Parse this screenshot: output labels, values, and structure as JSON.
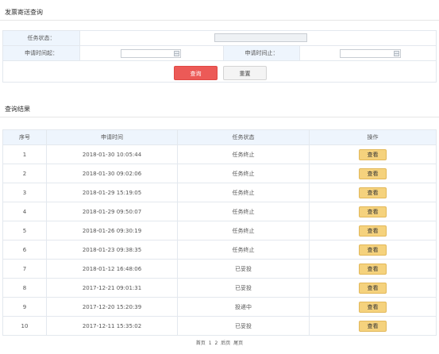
{
  "search_panel": {
    "title": "发票寄送查询"
  },
  "form": {
    "status_label": "任务状态：",
    "start_label": "申请时间起：",
    "end_label": "申请时间止：",
    "query_button": "查询",
    "reset_button": "重置"
  },
  "results_panel": {
    "title": "查询结果"
  },
  "table": {
    "headers": [
      "序号",
      "申请时间",
      "任务状态",
      "操作"
    ],
    "action_label": "查看",
    "rows": [
      {
        "no": "1",
        "time": "2018-01-30 10:05:44",
        "status": "任务终止"
      },
      {
        "no": "2",
        "time": "2018-01-30 09:02:06",
        "status": "任务终止"
      },
      {
        "no": "3",
        "time": "2018-01-29 15:19:05",
        "status": "任务终止"
      },
      {
        "no": "4",
        "time": "2018-01-29 09:50:07",
        "status": "任务终止"
      },
      {
        "no": "5",
        "time": "2018-01-26 09:30:19",
        "status": "任务终止"
      },
      {
        "no": "6",
        "time": "2018-01-23 09:38:35",
        "status": "任务终止"
      },
      {
        "no": "7",
        "time": "2018-01-12 16:48:06",
        "status": "已妥投"
      },
      {
        "no": "8",
        "time": "2017-12-21 09:01:31",
        "status": "已妥投"
      },
      {
        "no": "9",
        "time": "2017-12-20 15:20:39",
        "status": "投递中"
      },
      {
        "no": "10",
        "time": "2017-12-11 15:35:02",
        "status": "已妥投"
      }
    ]
  },
  "pagination": {
    "first": "首页",
    "page1": "1",
    "page2": "2",
    "next": "后页",
    "last": "尾页"
  }
}
